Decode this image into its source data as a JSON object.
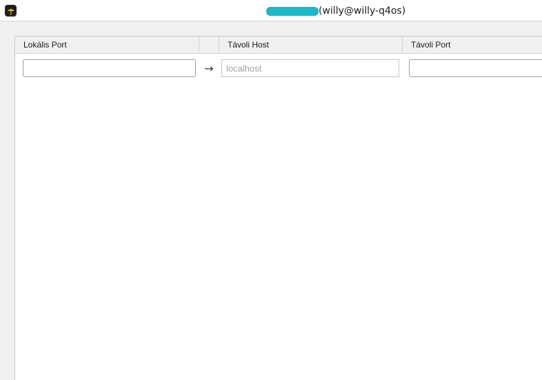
{
  "window": {
    "title": "(willy@willy-q4os)",
    "redaction_color": "#1bb9c8"
  },
  "table": {
    "headers": {
      "local_port": "Lokális Port",
      "arrow_column": "",
      "remote_host": "Távoli Host",
      "remote_port": "Távoli Port"
    },
    "row": {
      "local_port_value": "",
      "arrow": "→",
      "remote_host_value": "",
      "remote_host_placeholder": "localhost",
      "remote_port_value": ""
    }
  },
  "icons": {
    "app": "umbrella-app-icon",
    "arrow": "arrow-right-icon"
  }
}
